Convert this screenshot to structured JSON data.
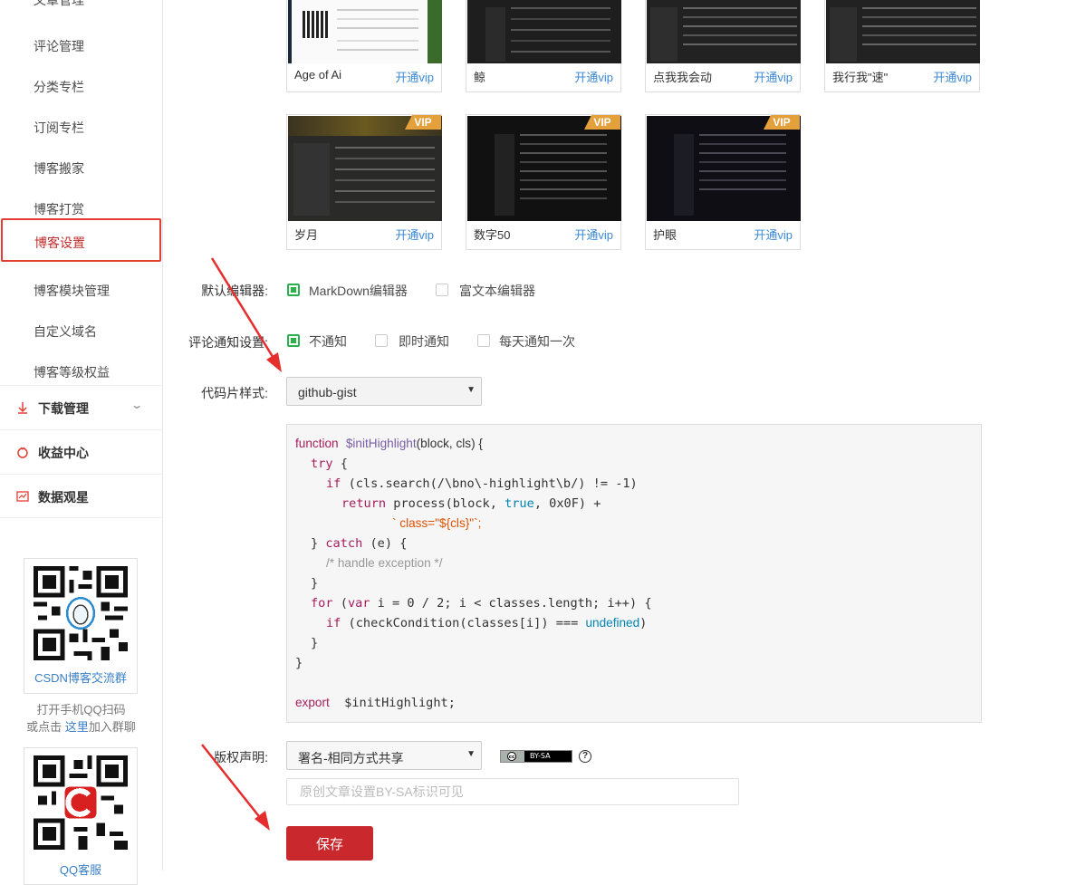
{
  "sidebar": {
    "items": [
      {
        "label": "文章管理"
      },
      {
        "label": "评论管理"
      },
      {
        "label": "分类专栏"
      },
      {
        "label": "订阅专栏"
      },
      {
        "label": "博客搬家"
      },
      {
        "label": "博客打赏"
      },
      {
        "label": "博客设置"
      },
      {
        "label": "博客模块管理"
      },
      {
        "label": "自定义域名"
      },
      {
        "label": "博客等级权益"
      }
    ],
    "groups": [
      {
        "label": "下载管理",
        "icon": "download-icon"
      },
      {
        "label": "收益中心",
        "icon": "coin-icon"
      },
      {
        "label": "数据观星",
        "icon": "chart-icon"
      }
    ],
    "qq_group": {
      "caption": "CSDN博客交流群",
      "hint_line1": "打开手机QQ扫码",
      "hint_prefix": "或点击",
      "hint_link": "这里",
      "hint_suffix": "加入群聊"
    },
    "qq_service": {
      "caption": "QQ客服"
    }
  },
  "themes": {
    "row1": [
      {
        "name": "Age of Ai",
        "action": "开通vip"
      },
      {
        "name": "鲸",
        "action": "开通vip"
      },
      {
        "name": "点我我会动",
        "action": "开通vip"
      },
      {
        "name": "我行我\"速\"",
        "action": "开通vip"
      }
    ],
    "row2": [
      {
        "name": "岁月",
        "action": "开通vip",
        "badge": "VIP"
      },
      {
        "name": "数字50",
        "action": "开通vip",
        "badge": "VIP"
      },
      {
        "name": "护眼",
        "action": "开通vip",
        "badge": "VIP"
      }
    ]
  },
  "editor": {
    "label": "默认编辑器:",
    "options": [
      {
        "label": "MarkDown编辑器",
        "checked": true
      },
      {
        "label": "富文本编辑器",
        "checked": false
      }
    ]
  },
  "comment_notify": {
    "label": "评论通知设置:",
    "options": [
      {
        "label": "不通知",
        "checked": true
      },
      {
        "label": "即时通知",
        "checked": false
      },
      {
        "label": "每天通知一次",
        "checked": false
      }
    ]
  },
  "code_style": {
    "label": "代码片样式:",
    "selected": "github-gist"
  },
  "code_preview": {
    "l1a": "function",
    "l1b": "$initHighlight",
    "l1c": "(block, cls) {",
    "l2": "try",
    "l3a": "if",
    "l3b": "(cls.search(/\\bno\\-highlight\\b/) != -1)",
    "l4a": "return",
    "l4b": "process(block,",
    "l4c": "true",
    "l4d": ", 0x0F) +",
    "l5": "` class=\"${cls}\"`;",
    "l6a": "} ",
    "l6b": "catch",
    "l6c": " (e) {",
    "l7": "/* handle exception */",
    "l8": "}",
    "l9a": "for",
    "l9b": " (",
    "l9c": "var",
    "l9d": " i = 0 / 2; i < classes.length; i++) {",
    "l10a": "if",
    "l10b": " (checkCondition(classes[i]) === ",
    "l10c": "undefined",
    "l10d": ")",
    "l11": "}",
    "l12": "}",
    "l13a": "export",
    "l13b": "  $initHighlight;"
  },
  "copyright": {
    "label": "版权声明:",
    "selected": "署名-相同方式共享",
    "license_badge": "BY-SA",
    "help_icon": "question-icon",
    "input_placeholder": "原创文章设置BY-SA标识可见"
  },
  "save_label": "保存",
  "colors": {
    "accent": "#c9282d",
    "link": "#3c8ad8",
    "check": "#2cb14a",
    "vip": "#e4a03b",
    "annotation_arrow": "#e62d2d"
  }
}
